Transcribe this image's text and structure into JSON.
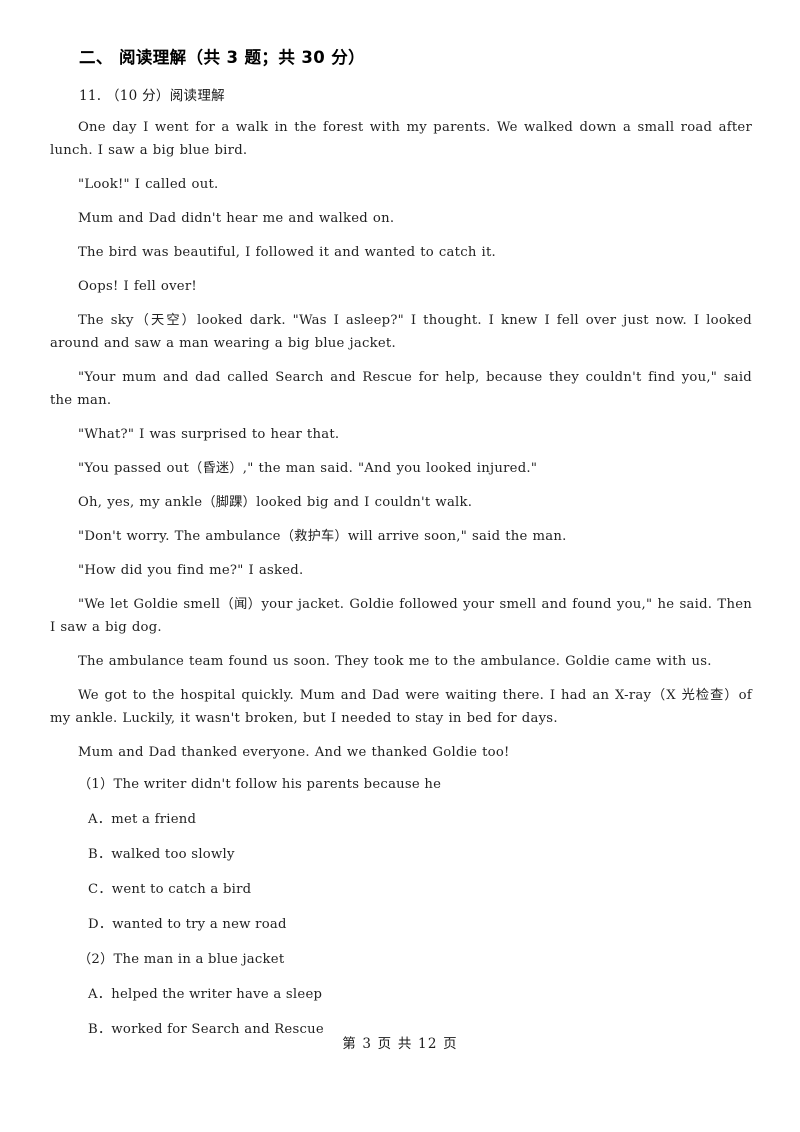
{
  "document": {
    "section_heading": "二、 阅读理解（共 3 题；共 30 分）",
    "question_head": "11. （10 分）阅读理解"
  },
  "passage": {
    "paragraphs": [
      "One day I went for a walk in the forest with my parents. We walked down a small road after lunch. I saw a big blue bird.",
      "\"Look!\" I called out.",
      "Mum and Dad didn't hear me and walked on.",
      "The bird was beautiful, I followed it and wanted to catch it.",
      "Oops! I fell over!",
      "The sky（天空）looked dark. \"Was I asleep?\" I thought. I knew I fell over just now. I looked around and saw a man wearing a big blue jacket.",
      "\"Your mum and dad called Search and Rescue for help, because they couldn't find you,\" said the man.",
      "\"What?\" I was surprised to hear that.",
      "\"You passed out（昏迷）,\" the man said. \"And you looked injured.\"",
      "Oh, yes, my ankle（脚踝）looked big and I couldn't walk.",
      "\"Don't worry. The ambulance（救护车）will arrive soon,\" said the man.",
      "\"How did you find me?\" I asked.",
      "\"We let Goldie smell（闻）your jacket. Goldie followed your smell and found you,\" he said. Then I saw a big dog.",
      "The ambulance team found us soon. They took me to the ambulance. Goldie came with us.",
      "We got to the hospital quickly. Mum and Dad were waiting there. I had an X-ray（X 光检查）of my ankle. Luckily, it wasn't broken, but I needed to stay in bed for days.",
      "Mum and Dad thanked everyone. And we thanked Goldie too!"
    ]
  },
  "questions": [
    {
      "stem": "（1）The writer didn't follow his parents because he",
      "options": [
        "A．met a friend",
        "B．walked too slowly",
        "C．went to catch a bird",
        "D．wanted to try a new road"
      ]
    },
    {
      "stem": "（2）The man in a blue jacket",
      "options": [
        "A．helped the writer have a sleep",
        "B．worked for Search and Rescue"
      ]
    }
  ],
  "footer": {
    "page_label": "第 3 页 共 12 页"
  }
}
